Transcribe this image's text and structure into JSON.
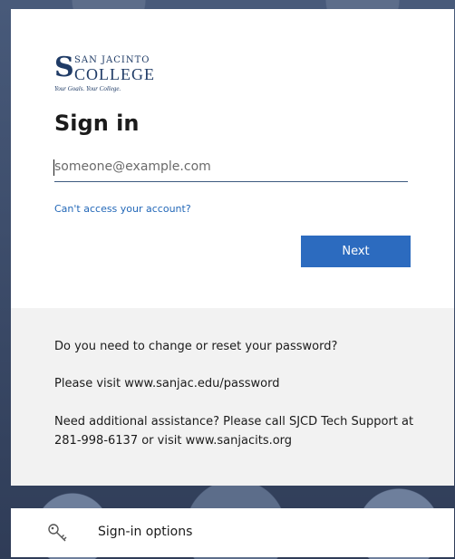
{
  "branding": {
    "logo_line1": "SAN JACINTO",
    "logo_line2": "COLLEGE",
    "tagline": "Your Goals. Your College."
  },
  "signin": {
    "title": "Sign in",
    "email_placeholder": "someone@example.com",
    "email_value": "",
    "cant_access_link": "Can't access your account?",
    "next_label": "Next"
  },
  "info": {
    "line1": "Do you need to change or reset your password?",
    "line2": "Please visit www.sanjac.edu/password",
    "line3": "Need additional assistance? Please call SJCD Tech Support at 281-998-6137 or visit www.sanjacits.org"
  },
  "options": {
    "label": "Sign-in options",
    "icon": "key-icon"
  },
  "colors": {
    "accent": "#2c6bbf",
    "link": "#2368b8",
    "brand": "#1f3b66"
  }
}
